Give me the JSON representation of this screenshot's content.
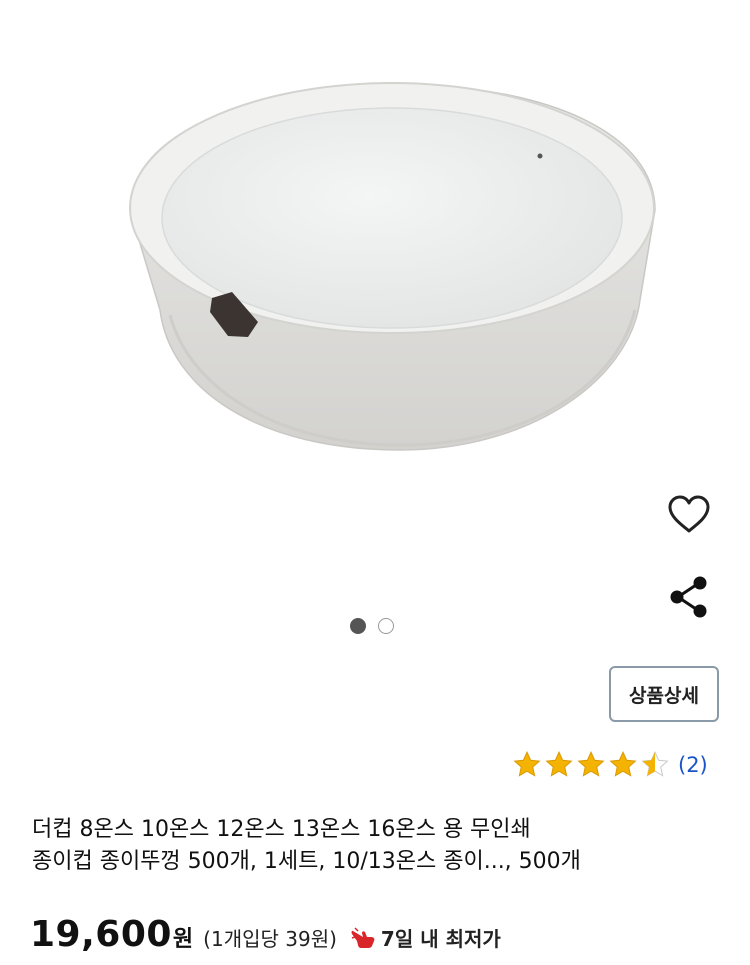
{
  "product": {
    "image_alt": "종이컵 종이뚜껑",
    "carousel": {
      "current": 1,
      "total": 2
    },
    "detail_button_label": "상품상세",
    "rating": {
      "value": 4.5,
      "max": 5,
      "count_label": "(2)"
    },
    "title_line1": "더컵 8온스 10온스 12온스 13온스 16온스 용 무인쇄",
    "title_line2": "종이컵 종이뚜껑 500개, 1세트, 10/13온스 종이..., 500개",
    "price": "19,600",
    "currency": "원",
    "unit_price": "(1개입당 39원)",
    "lowest_label": "7일 내 최저가"
  },
  "icons": {
    "wishlist": "heart-outline-icon",
    "share": "share-icon",
    "lowest": "pointing-hand-icon"
  },
  "colors": {
    "star": "#f5b301",
    "review_link": "#1a55c8",
    "hand": "#d8262b"
  }
}
